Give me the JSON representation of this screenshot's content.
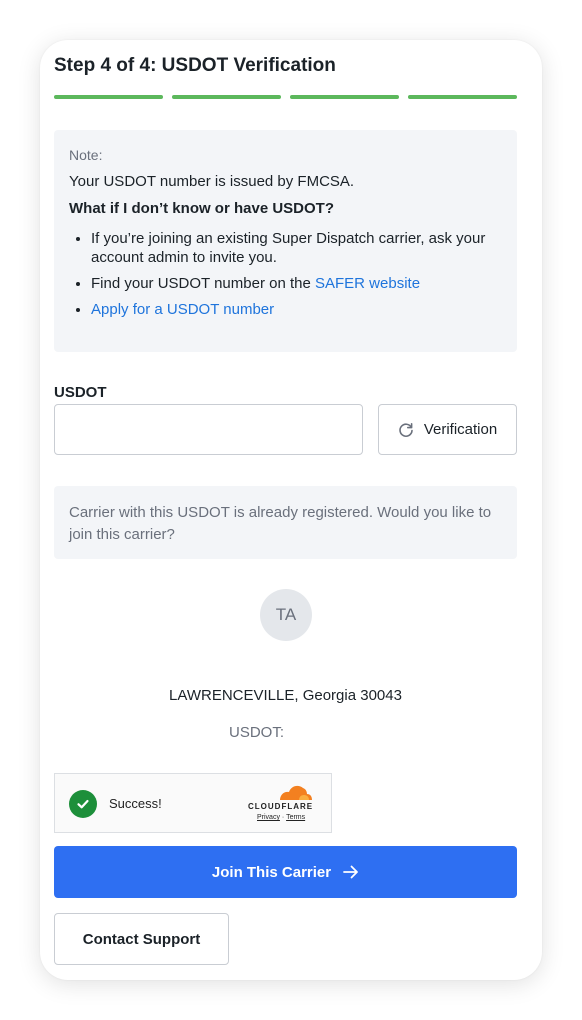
{
  "header": {
    "title": "Step 4 of 4: USDOT Verification",
    "progress_steps": 4,
    "progress_completed": 4,
    "progress_color": "#5cb85c"
  },
  "note": {
    "label": "Note:",
    "line": "Your USDOT number is issued by FMCSA.",
    "question": "What if I don’t know or have USDOT?",
    "bullet1": "If you’re joining an existing Super Dispatch carrier, ask your account admin to invite you.",
    "bullet2_prefix": "Find your USDOT number on the ",
    "bullet2_link": "SAFER website",
    "bullet3_link": "Apply for a USDOT number"
  },
  "usdot_field": {
    "label": "USDOT",
    "value": "",
    "placeholder": ""
  },
  "verify_button": {
    "label": "Verification",
    "icon": "refresh-icon"
  },
  "registered_notice": "Carrier with this USDOT is already registered. Would you like to join this carrier?",
  "carrier": {
    "initials": "TA",
    "location": "LAWRENCEVILLE, Georgia 30043",
    "usdot_line": "USDOT:"
  },
  "captcha": {
    "status": "Success!",
    "brand": "CLOUDFLARE",
    "privacy": "Privacy",
    "separator": "·",
    "terms": "Terms"
  },
  "actions": {
    "join_label": "Join This Carrier",
    "join_icon": "arrow-right-icon",
    "support_label": "Contact Support"
  },
  "colors": {
    "primary": "#2e6ff2",
    "link": "#1e74dc",
    "success": "#1d8f3a",
    "cloudflare_orange": "#f38020"
  }
}
